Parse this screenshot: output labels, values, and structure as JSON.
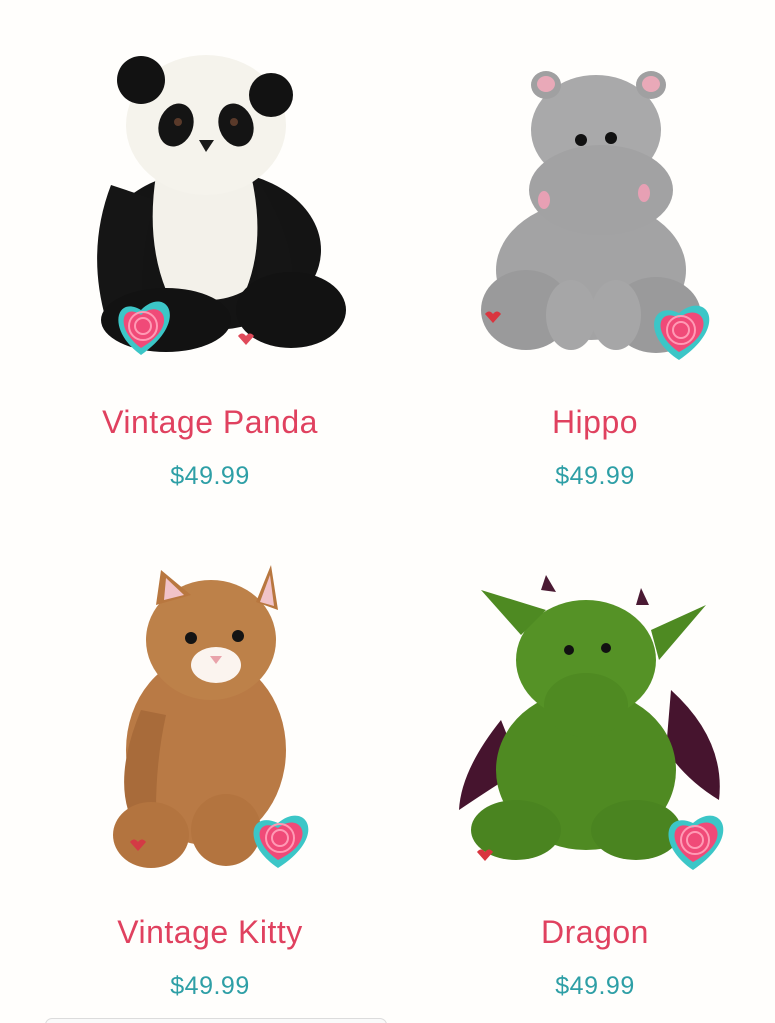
{
  "products": [
    {
      "name": "Vintage Panda",
      "price": "$49.99",
      "image_icon": "panda-plush-image"
    },
    {
      "name": "Hippo",
      "price": "$49.99",
      "image_icon": "hippo-plush-image"
    },
    {
      "name": "Vintage Kitty",
      "price": "$49.99",
      "image_icon": "kitty-plush-image"
    },
    {
      "name": "Dragon",
      "price": "$49.99",
      "image_icon": "dragon-plush-image"
    }
  ],
  "colors": {
    "name": "#e0415f",
    "price": "#2e9fa6",
    "heart_badge": "#f04a78",
    "heart_border": "#3cc6c7"
  }
}
